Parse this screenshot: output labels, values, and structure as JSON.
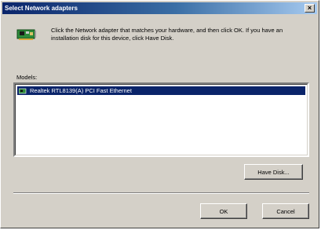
{
  "window": {
    "title": "Select Network adapters",
    "close_label": "×"
  },
  "dialog": {
    "instructions": "Click the Network adapter that matches your hardware, and then click OK. If you have an installation disk for this device, click Have Disk.",
    "models_label": "Models:",
    "models": [
      {
        "label": "Realtek RTL8139(A) PCI Fast Ethernet",
        "selected": true
      }
    ]
  },
  "buttons": {
    "have_disk_label": "Have Disk...",
    "ok_label": "OK",
    "cancel_label": "Cancel"
  },
  "icons": {
    "dialog_icon": "network-card-icon",
    "list_item_icon": "network-card-icon"
  },
  "colors": {
    "title_gradient_start": "#0a246a",
    "title_gradient_end": "#a6caf0",
    "selection": "#0a246a",
    "face": "#d4d0c8"
  }
}
